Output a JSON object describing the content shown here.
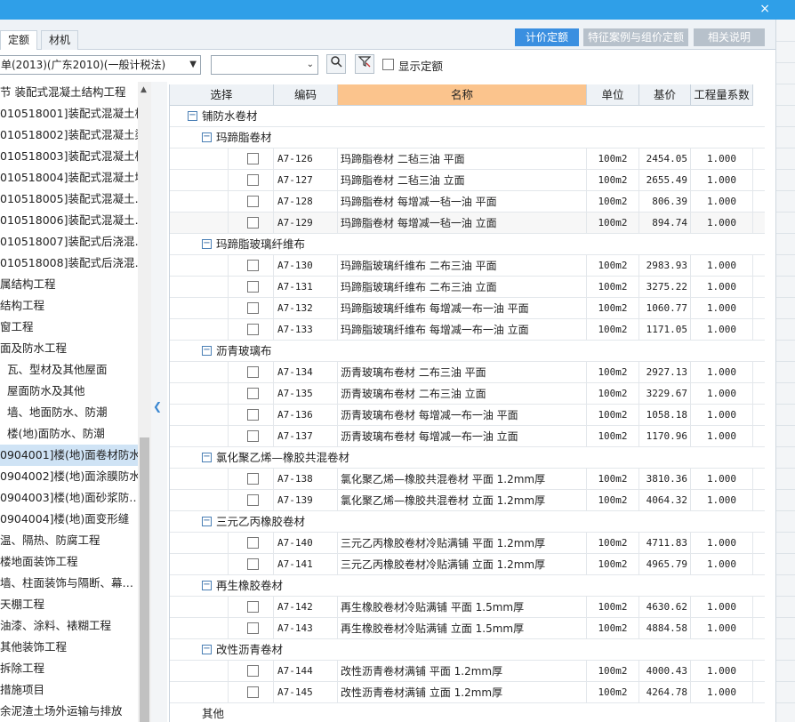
{
  "window": {
    "close_label": "×"
  },
  "tabs": [
    "定额",
    "材机"
  ],
  "top_buttons": [
    "计价定额",
    "特征案例与组价定额",
    "相关说明"
  ],
  "toolbar": {
    "library_value": "单(2013)(广东2010)(一般计税法)",
    "filter_value": "",
    "show_quota_label": "显示定额"
  },
  "tree": [
    "节  装配式混凝土结构工程",
    "010518001]装配式混凝土柱",
    "010518002]装配式混凝土梁",
    "010518003]装配式混凝土板",
    "010518004]装配式混凝土墙",
    "010518005]装配式混凝土…",
    "010518006]装配式混凝土…",
    "010518007]装配式后浇混…",
    "010518008]装配式后浇混…",
    "属结构工程",
    "结构工程",
    "窗工程",
    "面及防水工程",
    "  瓦、型材及其他屋面",
    "  屋面防水及其他",
    "  墙、地面防水、防潮",
    "  楼(地)面防水、防潮",
    "0904001]楼(地)面卷材防水",
    "0904002]楼(地)面涂膜防水",
    "0904003]楼(地)面砂浆防…",
    "0904004]楼(地)面变形缝",
    "温、隔热、防腐工程",
    "楼地面装饰工程",
    "墙、柱面装饰与隔断、幕…",
    "天棚工程",
    "油漆、涂料、裱糊工程",
    "其他装饰工程",
    "拆除工程",
    "措施项目",
    "余泥渣土场外运输与排放"
  ],
  "grid": {
    "headers": [
      "选择",
      "编码",
      "名称",
      "单位",
      "基价",
      "工程量系数"
    ],
    "root_label": "铺防水卷材",
    "other_label": "其他",
    "groups": [
      {
        "name": "玛蹄脂卷材",
        "items": [
          {
            "code": "A7-126",
            "name": "玛蹄脂卷材 二毡三油 平面",
            "unit": "100m2",
            "price": "2454.05",
            "coef": "1.000"
          },
          {
            "code": "A7-127",
            "name": "玛蹄脂卷材 二毡三油 立面",
            "unit": "100m2",
            "price": "2655.49",
            "coef": "1.000"
          },
          {
            "code": "A7-128",
            "name": "玛蹄脂卷材 每增减一毡一油 平面",
            "unit": "100m2",
            "price": "806.39",
            "coef": "1.000"
          },
          {
            "code": "A7-129",
            "name": "玛蹄脂卷材 每增减一毡一油 立面",
            "unit": "100m2",
            "price": "894.74",
            "coef": "1.000"
          }
        ]
      },
      {
        "name": "玛蹄脂玻璃纤维布",
        "items": [
          {
            "code": "A7-130",
            "name": "玛蹄脂玻璃纤维布 二布三油 平面",
            "unit": "100m2",
            "price": "2983.93",
            "coef": "1.000"
          },
          {
            "code": "A7-131",
            "name": "玛蹄脂玻璃纤维布 二布三油 立面",
            "unit": "100m2",
            "price": "3275.22",
            "coef": "1.000"
          },
          {
            "code": "A7-132",
            "name": "玛蹄脂玻璃纤维布 每增减一布一油 平面",
            "unit": "100m2",
            "price": "1060.77",
            "coef": "1.000"
          },
          {
            "code": "A7-133",
            "name": "玛蹄脂玻璃纤维布 每增减一布一油 立面",
            "unit": "100m2",
            "price": "1171.05",
            "coef": "1.000"
          }
        ]
      },
      {
        "name": "沥青玻璃布",
        "items": [
          {
            "code": "A7-134",
            "name": "沥青玻璃布卷材 二布三油 平面",
            "unit": "100m2",
            "price": "2927.13",
            "coef": "1.000"
          },
          {
            "code": "A7-135",
            "name": "沥青玻璃布卷材 二布三油 立面",
            "unit": "100m2",
            "price": "3229.67",
            "coef": "1.000"
          },
          {
            "code": "A7-136",
            "name": "沥青玻璃布卷材 每增减一布一油 平面",
            "unit": "100m2",
            "price": "1058.18",
            "coef": "1.000"
          },
          {
            "code": "A7-137",
            "name": "沥青玻璃布卷材 每增减一布一油 立面",
            "unit": "100m2",
            "price": "1170.96",
            "coef": "1.000"
          }
        ]
      },
      {
        "name": "氯化聚乙烯—橡胶共混卷材",
        "items": [
          {
            "code": "A7-138",
            "name": "氯化聚乙烯—橡胶共混卷材 平面 1.2mm厚",
            "unit": "100m2",
            "price": "3810.36",
            "coef": "1.000"
          },
          {
            "code": "A7-139",
            "name": "氯化聚乙烯—橡胶共混卷材 立面 1.2mm厚",
            "unit": "100m2",
            "price": "4064.32",
            "coef": "1.000"
          }
        ]
      },
      {
        "name": "三元乙丙橡胶卷材",
        "items": [
          {
            "code": "A7-140",
            "name": "三元乙丙橡胶卷材冷贴满铺 平面 1.2mm厚",
            "unit": "100m2",
            "price": "4711.83",
            "coef": "1.000"
          },
          {
            "code": "A7-141",
            "name": "三元乙丙橡胶卷材冷贴满铺 立面 1.2mm厚",
            "unit": "100m2",
            "price": "4965.79",
            "coef": "1.000"
          }
        ]
      },
      {
        "name": "再生橡胶卷材",
        "items": [
          {
            "code": "A7-142",
            "name": "再生橡胶卷材冷贴满铺 平面 1.5mm厚",
            "unit": "100m2",
            "price": "4630.62",
            "coef": "1.000"
          },
          {
            "code": "A7-143",
            "name": "再生橡胶卷材冷贴满铺 立面 1.5mm厚",
            "unit": "100m2",
            "price": "4884.58",
            "coef": "1.000"
          }
        ]
      },
      {
        "name": "改性沥青卷材",
        "items": [
          {
            "code": "A7-144",
            "name": "改性沥青卷材满铺 平面 1.2mm厚",
            "unit": "100m2",
            "price": "4000.43",
            "coef": "1.000"
          },
          {
            "code": "A7-145",
            "name": "改性沥青卷材满铺 立面 1.2mm厚",
            "unit": "100m2",
            "price": "4264.78",
            "coef": "1.000"
          }
        ]
      }
    ]
  },
  "colors": {
    "titlebar": "#2f9fe8",
    "active_button": "#3a8fe0",
    "inactive_button": "#b7c1cb",
    "name_header": "#fbc48d",
    "selected_tree": "#cfe3f5"
  },
  "icons": {
    "close": "close-icon",
    "search": "search-icon",
    "filter": "filter-icon",
    "collapse": "minus-box-icon",
    "splitter": "chevron-left-icon"
  }
}
